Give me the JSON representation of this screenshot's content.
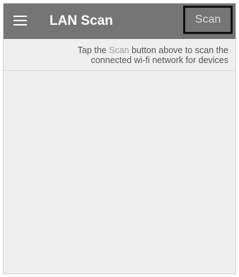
{
  "toolbar": {
    "menu_icon": "hamburger-menu-icon",
    "title": "LAN Scan",
    "scan_label": "Scan"
  },
  "instruction": {
    "before": "Tap the ",
    "highlight": "Scan",
    "line1_after": " button above to scan the",
    "line2": "connected wi-fi network for devices"
  },
  "colors": {
    "toolbar_bg": "#757575",
    "content_bg": "#efefef",
    "highlight_text": "#9e9e9e"
  }
}
